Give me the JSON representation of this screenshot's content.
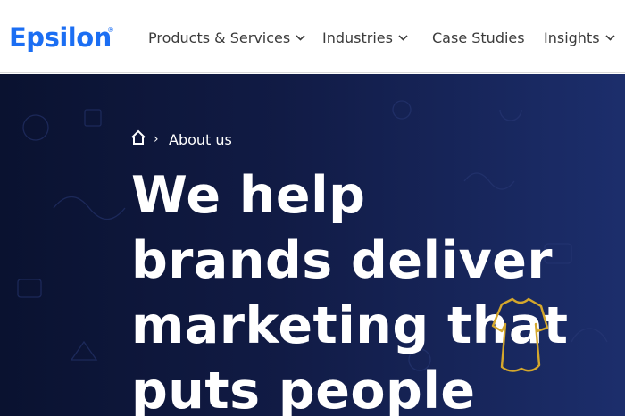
{
  "brand": {
    "logo": "Epsilon",
    "mark": "®",
    "color": "#1b6ef3"
  },
  "nav": {
    "items": [
      {
        "label": "Products & Services",
        "has_dropdown": true
      },
      {
        "label": "Industries",
        "has_dropdown": true
      },
      {
        "label": "Case Studies",
        "has_dropdown": false
      },
      {
        "label": "Insights",
        "has_dropdown": true
      }
    ]
  },
  "breadcrumb": {
    "home_icon": "home-icon",
    "separator": "›",
    "current": "About us"
  },
  "hero": {
    "headline_lines": [
      "We help",
      "brands deliver",
      "marketing that",
      "puts people"
    ],
    "background_colors": [
      "#0a1230",
      "#1c2e6c"
    ],
    "accent_icon": "dress-icon",
    "accent_color": "#d4a72c"
  }
}
